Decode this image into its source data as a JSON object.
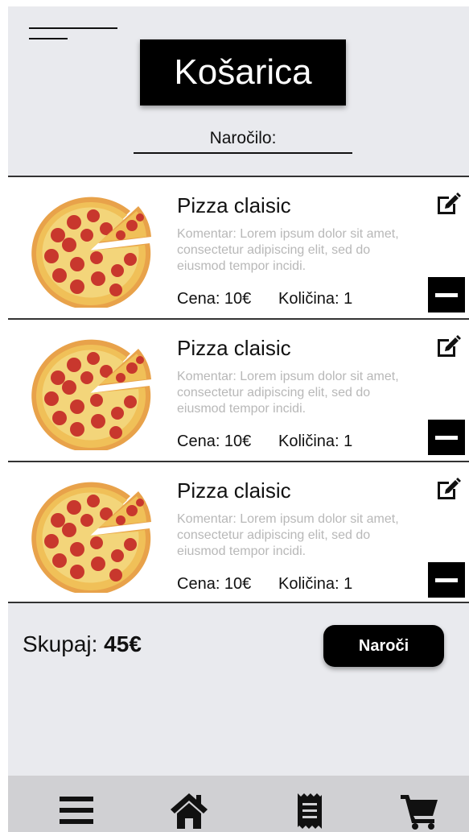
{
  "header": {
    "title": "Košarica",
    "order_label": "Naročilo:"
  },
  "items": [
    {
      "name": "Pizza claisic",
      "comment": "Komentar: Lorem ipsum dolor sit amet, consectetur adipiscing elit, sed do eiusmod tempor incidi.",
      "price": "Cena: 10€",
      "quantity": "Količina: 1"
    },
    {
      "name": "Pizza claisic",
      "comment": "Komentar: Lorem ipsum dolor sit amet, consectetur adipiscing elit, sed do eiusmod tempor incidi.",
      "price": "Cena: 10€",
      "quantity": "Količina: 1"
    },
    {
      "name": "Pizza claisic",
      "comment": "Komentar: Lorem ipsum dolor sit amet, consectetur adipiscing elit, sed do eiusmod tempor incidi.",
      "price": "Cena: 10€",
      "quantity": "Količina: 1"
    }
  ],
  "summary": {
    "total_label": "Skupaj: ",
    "total_value": "45€",
    "order_button": "Naroči"
  },
  "icons": {
    "menu": "menu-icon",
    "edit": "edit-icon",
    "remove": "minus-icon",
    "nav": [
      "hamburger-menu-icon",
      "home-icon",
      "receipt-icon",
      "cart-icon"
    ]
  },
  "colors": {
    "background": "#e9eaee",
    "accent": "#000000",
    "card": "#ffffff",
    "nav_bar": "#d0d0d3"
  }
}
